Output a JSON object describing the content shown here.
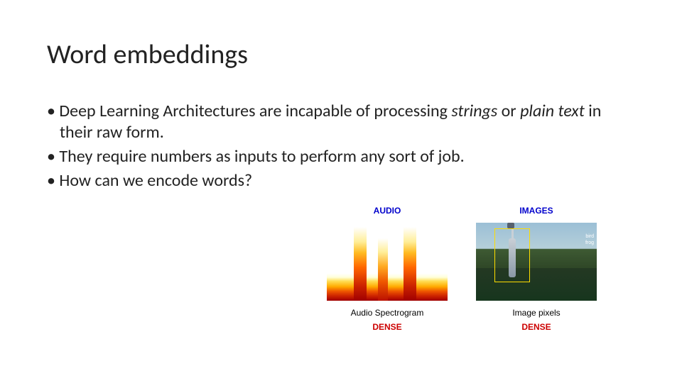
{
  "title": "Word embeddings",
  "bullets": {
    "b1_pre": "Deep Learning Architectures are incapable of processing ",
    "b1_em1": "strings",
    "b1_mid": " or ",
    "b1_em2": "plain text",
    "b1_post": " in their raw form.",
    "b2": "They require numbers as inputs to perform any sort of job.",
    "b3": "How can we encode words?"
  },
  "figure": {
    "audio": {
      "header": "AUDIO",
      "caption": "Audio Spectrogram",
      "dense": "DENSE"
    },
    "images": {
      "header": "IMAGES",
      "caption": "Image pixels",
      "dense": "DENSE",
      "label1": "bird",
      "label2": "frog"
    }
  }
}
